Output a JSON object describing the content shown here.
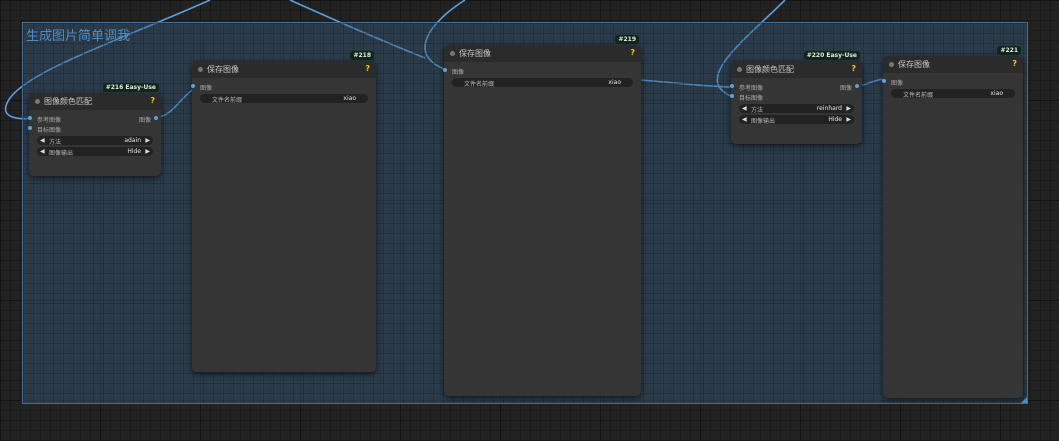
{
  "group": {
    "title": "生成图片简单调我"
  },
  "nodes": {
    "n216": {
      "badge": "#216 Easy-Use",
      "title": "图像颜色匹配",
      "help": "?",
      "inputs": [
        "参考图像",
        "目标图像"
      ],
      "output": "图像",
      "widgets": [
        {
          "label": "方法",
          "value": "adain"
        },
        {
          "label": "图像输出",
          "value": "Hide"
        }
      ]
    },
    "n218": {
      "badge": "#218",
      "title": "保存图像",
      "help": "?",
      "input": "图像",
      "widget": {
        "label": "文件名前缀",
        "value": "xiao"
      }
    },
    "n219": {
      "badge": "#219",
      "title": "保存图像",
      "help": "?",
      "input": "图像",
      "widget": {
        "label": "文件名前缀",
        "value": "xiao"
      }
    },
    "n220": {
      "badge": "#220 Easy-Use",
      "title": "图像颜色匹配",
      "help": "?",
      "inputs": [
        "参考图像",
        "目标图像"
      ],
      "output": "图像",
      "widgets": [
        {
          "label": "方法",
          "value": "reinhard"
        },
        {
          "label": "图像输出",
          "value": "Hide"
        }
      ]
    },
    "n221": {
      "badge": "#221",
      "title": "保存图像",
      "help": "?",
      "input": "图像",
      "widget": {
        "label": "文件名前缀",
        "value": "xiao"
      }
    }
  },
  "colors": {
    "link": "#5aa0e0",
    "group_title": "#4f8fc6",
    "help": "#f5c518"
  },
  "icons": {
    "arrow_left": "◀",
    "arrow_right": "▶"
  }
}
